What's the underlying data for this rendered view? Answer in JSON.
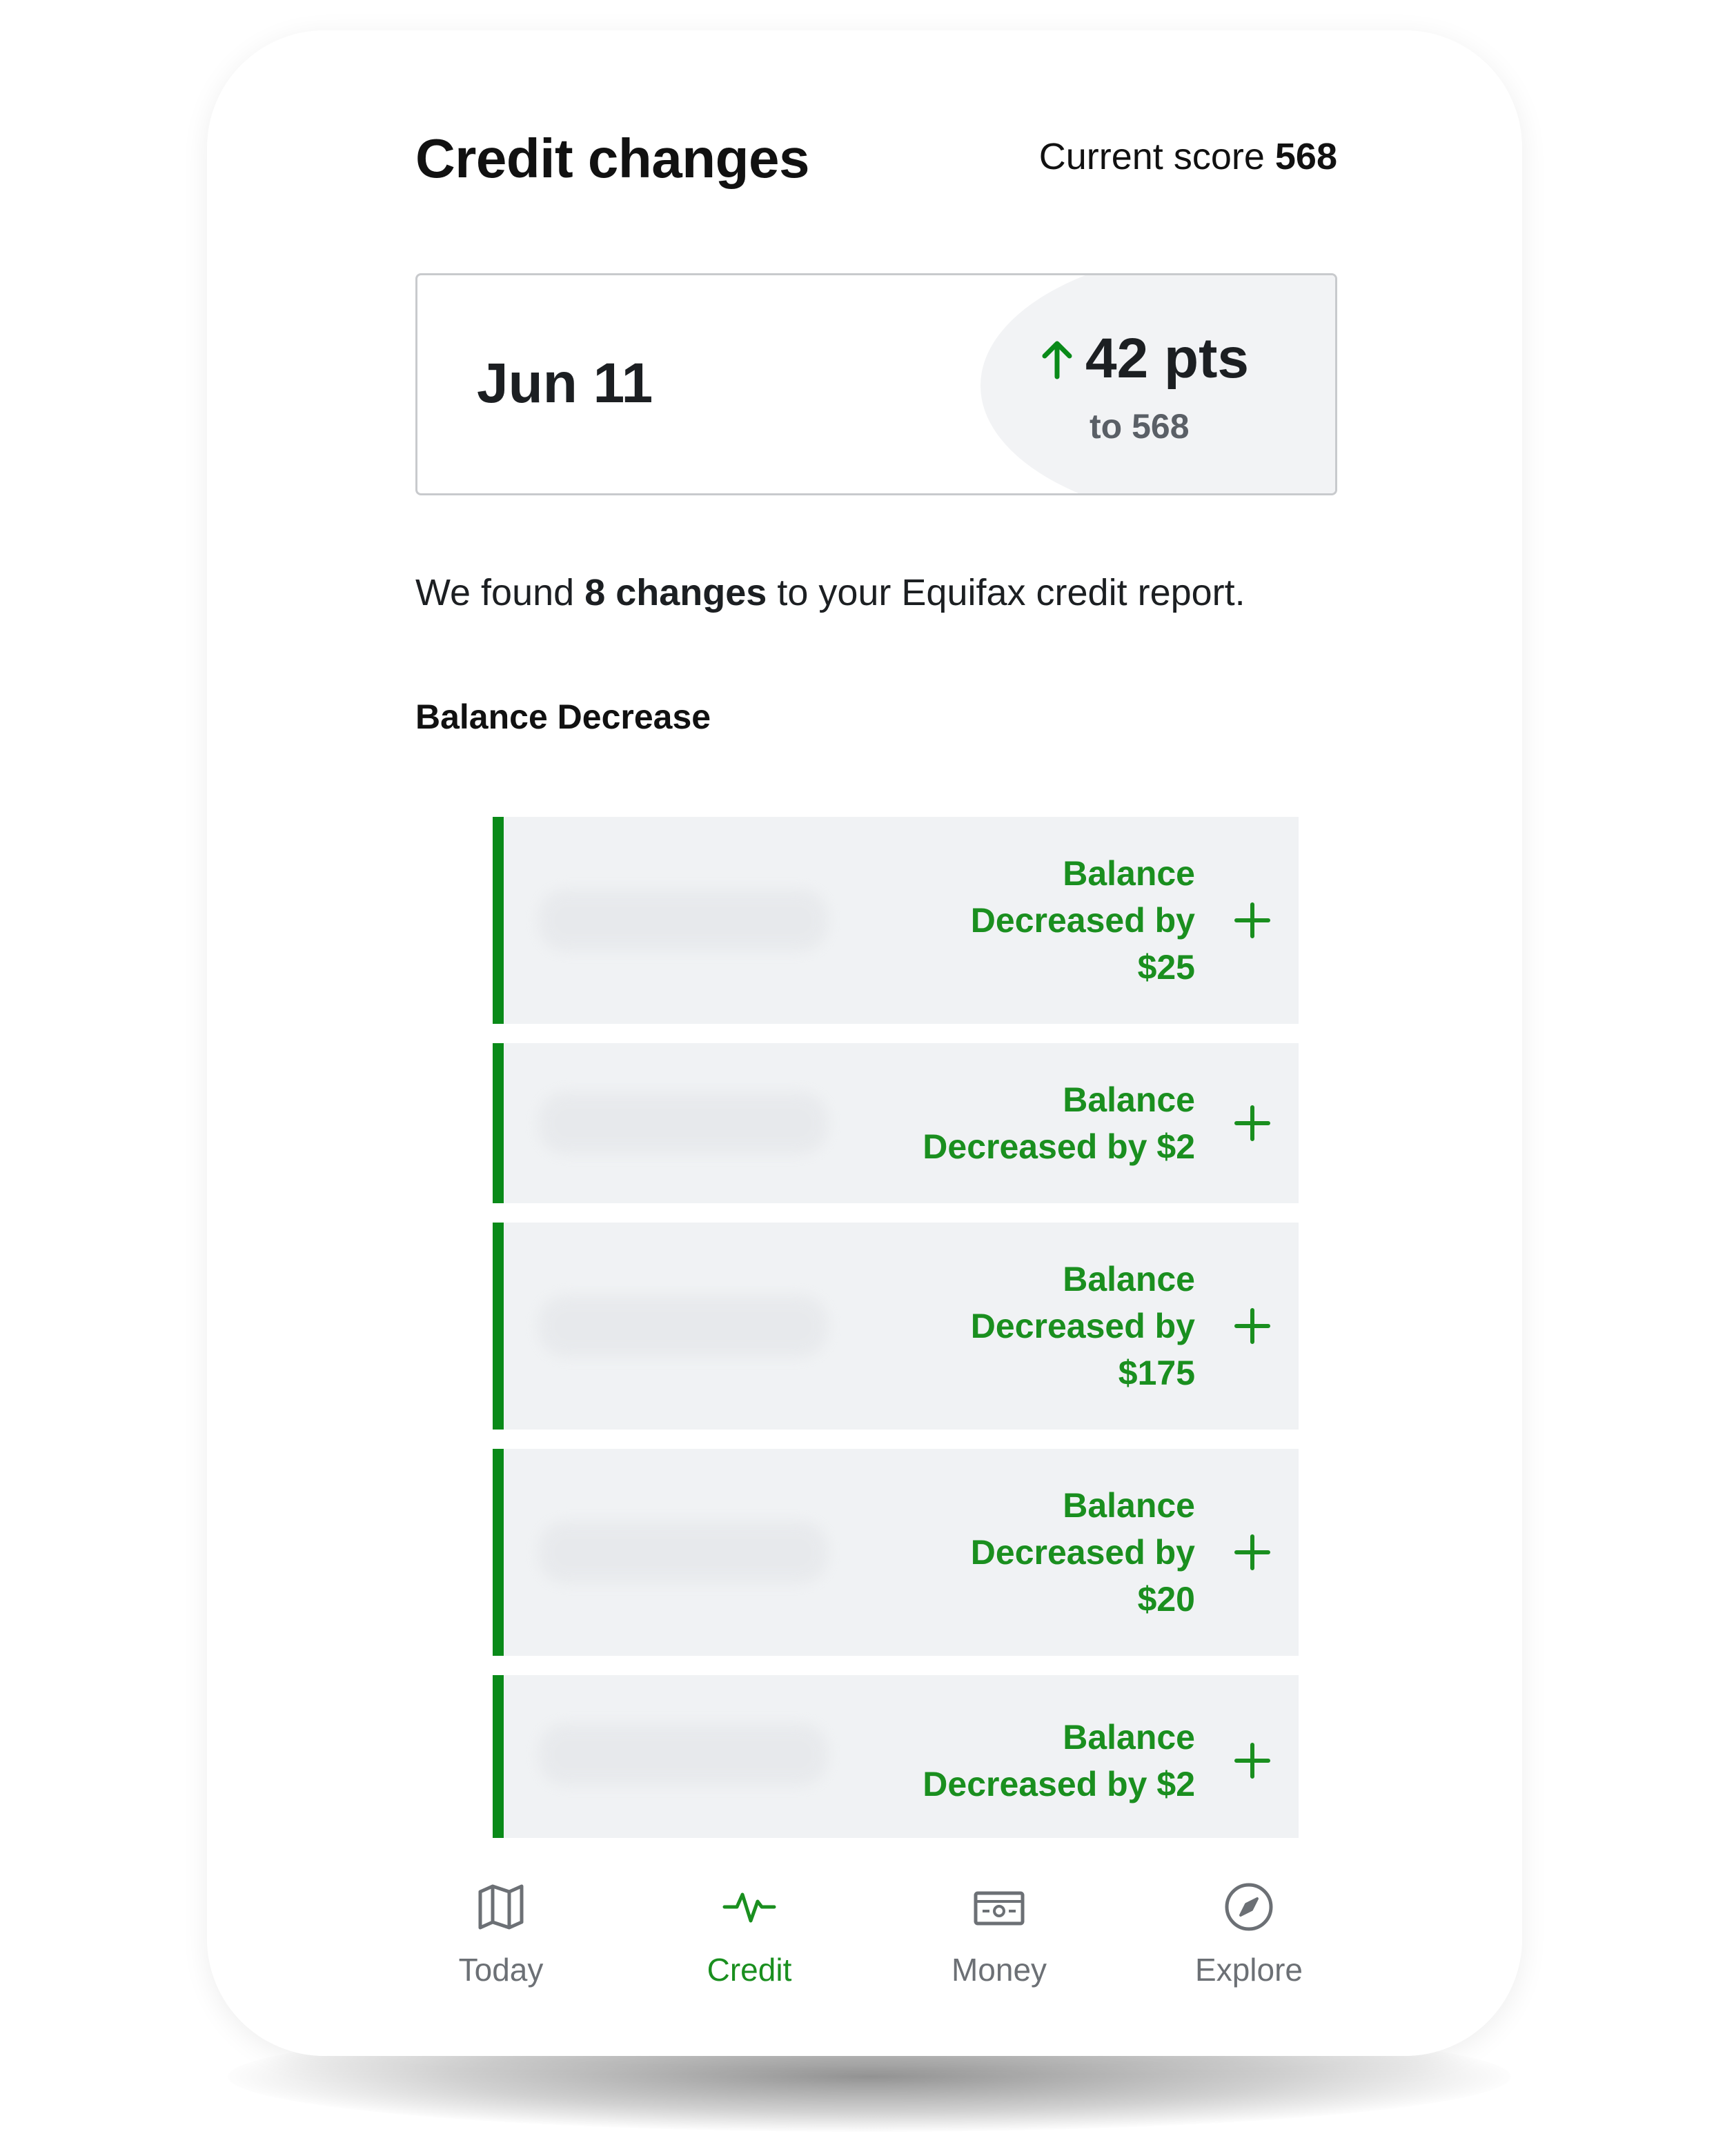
{
  "header": {
    "title": "Credit changes",
    "current_score_label": "Current score",
    "current_score_value": "568"
  },
  "summary": {
    "date": "Jun 11",
    "delta": "42 pts",
    "delta_direction_icon": "arrow-up-icon",
    "delta_sub": "to 568"
  },
  "found": {
    "prefix": "We found",
    "count": "8 changes",
    "suffix": "to your Equifax credit report."
  },
  "section": {
    "title": "Balance Decrease"
  },
  "changes": [
    {
      "lines": [
        "Balance",
        "Decreased by",
        "$25"
      ],
      "icon": "plus-icon"
    },
    {
      "lines": [
        "Balance",
        "Decreased by $2"
      ],
      "icon": "plus-icon"
    },
    {
      "lines": [
        "Balance",
        "Decreased by",
        "$175"
      ],
      "icon": "plus-icon"
    },
    {
      "lines": [
        "Balance",
        "Decreased by",
        "$20"
      ],
      "icon": "plus-icon"
    },
    {
      "lines": [
        "Balance",
        "Decreased by $2"
      ],
      "icon": "plus-icon"
    }
  ],
  "nav": {
    "items": [
      {
        "label": "Today",
        "icon": "map-icon",
        "active": false
      },
      {
        "label": "Credit",
        "icon": "pulse-icon",
        "active": true
      },
      {
        "label": "Money",
        "icon": "banknote-icon",
        "active": false
      },
      {
        "label": "Explore",
        "icon": "compass-icon",
        "active": false
      }
    ]
  },
  "colors": {
    "accent_green": "#0a8a19",
    "row_background": "#f0f2f4",
    "text_dark": "#1c1f22",
    "nav_inactive": "#6c7075"
  }
}
